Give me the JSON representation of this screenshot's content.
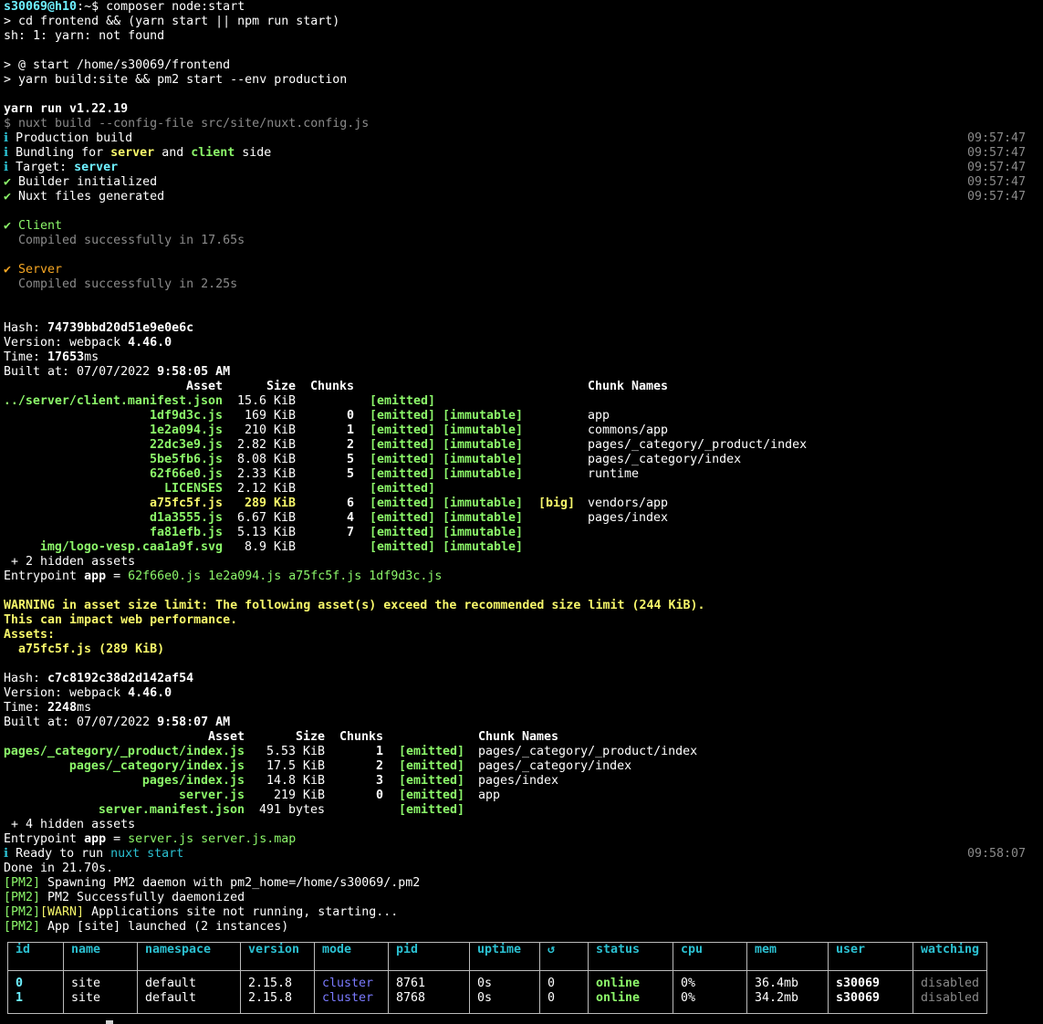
{
  "prompt": {
    "user_host": "s30069@h10",
    "path": ":~$",
    "command": " composer node:start"
  },
  "lines": {
    "l2": "> cd frontend && (yarn start || npm run start)",
    "l3": "sh: 1: yarn: not found",
    "l5": "> @ start /home/s30069/frontend",
    "l6": "> yarn build:site && pm2 start --env production",
    "yarn_run": "yarn run v1.22.19",
    "nuxt_build": "$ nuxt build --config-file src/site/nuxt.config.js"
  },
  "build_info": [
    {
      "icon": "ℹ",
      "pre": " Production build",
      "hl": "",
      "mid": "",
      "hl2": "",
      "post": "",
      "time": "09:57:47"
    },
    {
      "icon": "ℹ",
      "pre": " Bundling for ",
      "hl": "server",
      "mid": " and ",
      "hl2": "client",
      "post": " side",
      "time": "09:57:47"
    },
    {
      "icon": "ℹ",
      "pre": " Target: ",
      "hl": "server",
      "mid": "",
      "hl2": "",
      "post": "",
      "time": "09:57:47"
    },
    {
      "icon": "✔",
      "pre": " Builder initialized",
      "hl": "",
      "mid": "",
      "hl2": "",
      "post": "",
      "time": "09:57:47"
    },
    {
      "icon": "✔",
      "pre": " Nuxt files generated",
      "hl": "",
      "mid": "",
      "hl2": "",
      "post": "",
      "time": "09:57:47"
    }
  ],
  "client": {
    "check": "✔",
    "label": " Client",
    "compiled": "  Compiled successfully in 17.65s"
  },
  "server": {
    "check": "✔",
    "label": " Server",
    "compiled": "  Compiled successfully in 2.25s"
  },
  "build1": {
    "hash_label": "Hash: ",
    "hash": "74739bbd20d51e9e0e6c",
    "version_label": "Version: webpack ",
    "version": "4.46.0",
    "time_label": "Time: ",
    "time": "17653",
    "time_unit": "ms",
    "built_label": "Built at: 07/07/2022 ",
    "built_time": "9:58:05 AM",
    "headers": {
      "asset": "Asset",
      "size": "Size",
      "chunks": "Chunks",
      "names": "Chunk Names"
    },
    "rows": [
      {
        "asset": "../server/client.manifest.json",
        "size": "15.6 KiB",
        "chunk": "",
        "emitted": "[emitted]",
        "immutable": "",
        "big": "",
        "name": "",
        "warn": false
      },
      {
        "asset": "1df9d3c.js",
        "size": "169 KiB",
        "chunk": "0",
        "emitted": "[emitted]",
        "immutable": "[immutable]",
        "big": "",
        "name": "app",
        "warn": false
      },
      {
        "asset": "1e2a094.js",
        "size": "210 KiB",
        "chunk": "1",
        "emitted": "[emitted]",
        "immutable": "[immutable]",
        "big": "",
        "name": "commons/app",
        "warn": false
      },
      {
        "asset": "22dc3e9.js",
        "size": "2.82 KiB",
        "chunk": "2",
        "emitted": "[emitted]",
        "immutable": "[immutable]",
        "big": "",
        "name": "pages/_category/_product/index",
        "warn": false
      },
      {
        "asset": "5be5fb6.js",
        "size": "8.08 KiB",
        "chunk": "5",
        "emitted": "[emitted]",
        "immutable": "[immutable]",
        "big": "",
        "name": "pages/_category/index",
        "warn": false
      },
      {
        "asset": "62f66e0.js",
        "size": "2.33 KiB",
        "chunk": "5",
        "emitted": "[emitted]",
        "immutable": "[immutable]",
        "big": "",
        "name": "runtime",
        "warn": false
      },
      {
        "asset": "LICENSES",
        "size": "2.12 KiB",
        "chunk": "",
        "emitted": "[emitted]",
        "immutable": "",
        "big": "",
        "name": "",
        "warn": false
      },
      {
        "asset": "a75fc5f.js",
        "size": "289 KiB",
        "chunk": "6",
        "emitted": "[emitted]",
        "immutable": "[immutable]",
        "big": "[big]",
        "name": "vendors/app",
        "warn": true
      },
      {
        "asset": "d1a3555.js",
        "size": "6.67 KiB",
        "chunk": "4",
        "emitted": "[emitted]",
        "immutable": "[immutable]",
        "big": "",
        "name": "pages/index",
        "warn": false
      },
      {
        "asset": "fa81efb.js",
        "size": "5.13 KiB",
        "chunk": "7",
        "emitted": "[emitted]",
        "immutable": "[immutable]",
        "big": "",
        "name": "",
        "warn": false
      },
      {
        "asset": "img/logo-vesp.caa1a9f.svg",
        "size": "8.9 KiB",
        "chunk": "",
        "emitted": "[emitted]",
        "immutable": "[immutable]",
        "big": "",
        "name": "",
        "warn": false
      }
    ],
    "hidden": " + 2 hidden assets",
    "entry_label": "Entrypoint ",
    "entry_name": "app",
    "entry_eq": " = ",
    "entry_files": "62f66e0.js 1e2a094.js a75fc5f.js 1df9d3c.js"
  },
  "warning": {
    "l1": "WARNING in asset size limit: The following asset(s) exceed the recommended size limit (244 KiB).",
    "l2": "This can impact web performance.",
    "l3": "Assets:",
    "l4": "  a75fc5f.js (289 KiB)"
  },
  "build2": {
    "hash_label": "Hash: ",
    "hash": "c7c8192c38d2d142af54",
    "version_label": "Version: webpack ",
    "version": "4.46.0",
    "time_label": "Time: ",
    "time": "2248",
    "time_unit": "ms",
    "built_label": "Built at: 07/07/2022 ",
    "built_time": "9:58:07 AM",
    "headers": {
      "asset": "Asset",
      "size": "Size",
      "chunks": "Chunks",
      "names": "Chunk Names"
    },
    "rows": [
      {
        "asset": "pages/_category/_product/index.js",
        "size": "5.53 KiB",
        "chunk": "1",
        "emitted": "[emitted]",
        "name": "pages/_category/_product/index"
      },
      {
        "asset": "pages/_category/index.js",
        "size": "17.5 KiB",
        "chunk": "2",
        "emitted": "[emitted]",
        "name": "pages/_category/index"
      },
      {
        "asset": "pages/index.js",
        "size": "14.8 KiB",
        "chunk": "3",
        "emitted": "[emitted]",
        "name": "pages/index"
      },
      {
        "asset": "server.js",
        "size": "219 KiB",
        "chunk": "0",
        "emitted": "[emitted]",
        "name": "app"
      },
      {
        "asset": "server.manifest.json",
        "size": "491 bytes",
        "chunk": "",
        "emitted": "[emitted]",
        "name": ""
      }
    ],
    "hidden": " + 4 hidden assets",
    "entry_label": "Entrypoint ",
    "entry_name": "app",
    "entry_eq": " = ",
    "entry_files": "server.js server.js.map"
  },
  "ready": {
    "icon": "ℹ",
    "text": " Ready to run ",
    "cmd": "nuxt start",
    "time": "09:58:07"
  },
  "done": "Done in 21.70s.",
  "pm2_lines": [
    {
      "tag": "[PM2]",
      "warn": "",
      "text": " Spawning PM2 daemon with pm2_home=/home/s30069/.pm2"
    },
    {
      "tag": "[PM2]",
      "warn": "",
      "text": " PM2 Successfully daemonized"
    },
    {
      "tag": "[PM2]",
      "warn": "[WARN]",
      "text": " Applications site not running, starting..."
    },
    {
      "tag": "[PM2]",
      "warn": "",
      "text": " App [site] launched (2 instances)"
    }
  ],
  "pm2_table": {
    "headers": [
      "id",
      "name",
      "namespace",
      "version",
      "mode",
      "pid",
      "uptime",
      "↺",
      "status",
      "cpu",
      "mem",
      "user",
      "watching"
    ],
    "rows": [
      {
        "id": "0",
        "name": "site",
        "namespace": "default",
        "version": "2.15.8",
        "mode": "cluster",
        "pid": "8761",
        "uptime": "0s",
        "restarts": "0",
        "status": "online",
        "cpu": "0%",
        "mem": "36.4mb",
        "user": "s30069",
        "watching": "disabled"
      },
      {
        "id": "1",
        "name": "site",
        "namespace": "default",
        "version": "2.15.8",
        "mode": "cluster",
        "pid": "8768",
        "uptime": "0s",
        "restarts": "0",
        "status": "online",
        "cpu": "0%",
        "mem": "34.2mb",
        "user": "s30069",
        "watching": "disabled"
      }
    ]
  },
  "colors": {
    "background": "#000000",
    "text": "#d0d0d0",
    "green": "#8cf76a",
    "yellow": "#f7f76a",
    "orange": "#f5a623",
    "cyan": "#2bc0d1",
    "gray": "#8a8a8a",
    "blue": "#7a7aff"
  }
}
